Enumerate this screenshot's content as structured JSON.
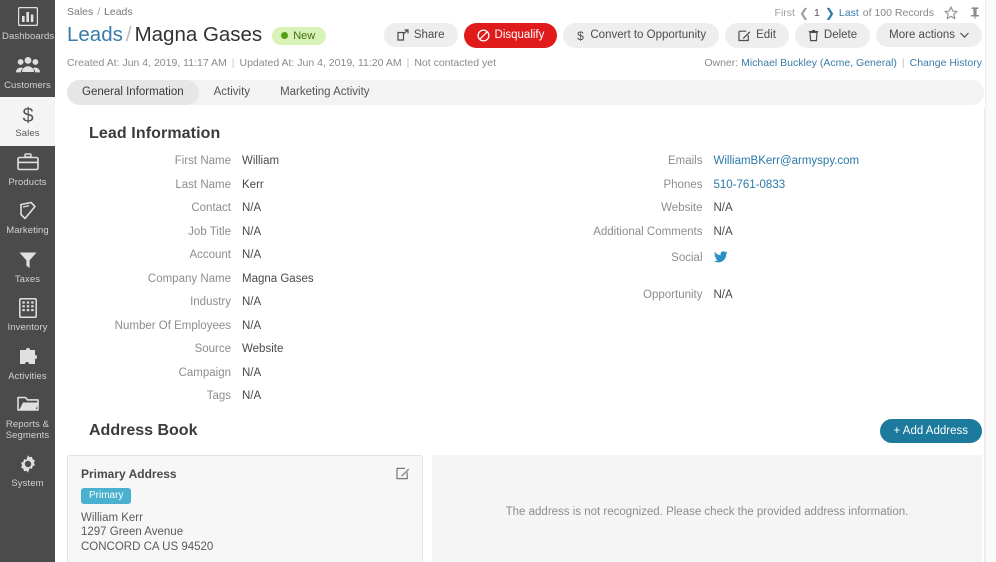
{
  "sidebar": {
    "items": [
      {
        "label": "Dashboards",
        "icon": "dashboard-chart-icon",
        "active": false
      },
      {
        "label": "Customers",
        "icon": "customers-people-icon",
        "active": false
      },
      {
        "label": "Sales",
        "icon": "sales-dollar-icon",
        "active": true
      },
      {
        "label": "Products",
        "icon": "products-briefcase-icon",
        "active": false
      },
      {
        "label": "Marketing",
        "icon": "marketing-book-icon",
        "active": false
      },
      {
        "label": "Taxes",
        "icon": "taxes-funnel-icon",
        "active": false
      },
      {
        "label": "Inventory",
        "icon": "inventory-grid-icon",
        "active": false
      },
      {
        "label": "Activities",
        "icon": "activities-puzzle-icon",
        "active": false
      },
      {
        "label": "Reports & Segments",
        "icon": "reports-folder-icon",
        "active": false
      },
      {
        "label": "System",
        "icon": "system-gear-icon",
        "active": false
      }
    ]
  },
  "header": {
    "breadcrumb_root": "Sales",
    "breadcrumb_sep": "/",
    "breadcrumb_leaf": "Leads",
    "title_link": "Leads",
    "title_sep": "/",
    "title_name": "Magna Gases",
    "status_badge": "New",
    "status_badge_color": "#d9f2b8",
    "status_dot_color": "#54a213",
    "created_at": "Created At: Jun 4, 2019, 11:17 AM",
    "updated_at": "Updated At: Jun 4, 2019, 11:20 AM",
    "contact_status": "Not contacted yet",
    "owner_prefix": "Owner:",
    "owner_name": "Michael Buckley (Acme, General)",
    "change_history": "Change History"
  },
  "record_nav": {
    "first": "First",
    "current": "1",
    "last": "Last",
    "count": "of 100 Records",
    "favorite_icon": "star-icon",
    "pin_icon": "pin-icon"
  },
  "actions": [
    {
      "label": "Share",
      "icon": "share-icon",
      "style": "default"
    },
    {
      "label": "Disqualify",
      "icon": "disqualify-ban-icon",
      "style": "danger"
    },
    {
      "label": "Convert to Opportunity",
      "icon": "dollar-icon",
      "style": "default"
    },
    {
      "label": "Edit",
      "icon": "edit-pencil-icon",
      "style": "default"
    },
    {
      "label": "Delete",
      "icon": "trash-icon",
      "style": "default"
    },
    {
      "label": "More actions",
      "icon": "caret-down-icon",
      "style": "default"
    }
  ],
  "tabs": [
    {
      "label": "General Information",
      "active": true
    },
    {
      "label": "Activity",
      "active": false
    },
    {
      "label": "Marketing Activity",
      "active": false
    }
  ],
  "lead_information": {
    "section_title": "Lead Information",
    "left_fields": [
      {
        "label": "First Name",
        "value": "William",
        "link": false
      },
      {
        "label": "Last Name",
        "value": "Kerr",
        "link": false
      },
      {
        "label": "Contact",
        "value": "N/A",
        "link": false
      },
      {
        "label": "Job Title",
        "value": "N/A",
        "link": false
      },
      {
        "label": "Account",
        "value": "N/A",
        "link": false
      },
      {
        "label": "Company Name",
        "value": "Magna Gases",
        "link": false
      },
      {
        "label": "Industry",
        "value": "N/A",
        "link": false
      },
      {
        "label": "Number Of Employees",
        "value": "N/A",
        "link": false
      },
      {
        "label": "Source",
        "value": "Website",
        "link": false
      },
      {
        "label": "Campaign",
        "value": "N/A",
        "link": false
      },
      {
        "label": "Tags",
        "value": "N/A",
        "link": false
      }
    ],
    "right_fields": [
      {
        "label": "Emails",
        "value": "WilliamBKerr@armyspy.com",
        "link": true
      },
      {
        "label": "Phones",
        "value": "510-761-0833",
        "link": true
      },
      {
        "label": "Website",
        "value": "N/A",
        "link": false
      },
      {
        "label": "Additional Comments",
        "value": "N/A",
        "link": false
      }
    ],
    "social_label": "Social",
    "social_icon": "twitter-icon",
    "opportunity_label": "Opportunity",
    "opportunity_value": "N/A"
  },
  "address_book": {
    "section_title": "Address Book",
    "add_button": "+ Add Address",
    "card": {
      "title": "Primary Address",
      "tag": "Primary",
      "edit_icon": "edit-pencil-icon",
      "line1": "William Kerr",
      "line2": "1297 Green Avenue",
      "line3": "CONCORD CA US 94520"
    },
    "map_message": "The address is not recognized. Please check the provided address information."
  }
}
